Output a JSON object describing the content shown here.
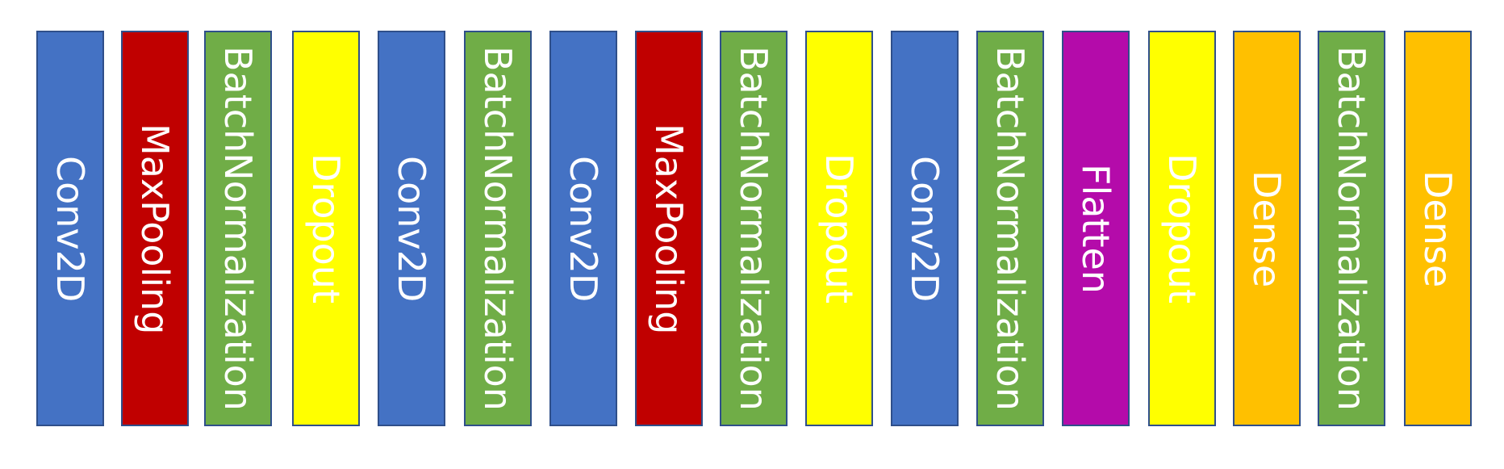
{
  "layers": [
    {
      "label": "Conv2D",
      "color": "#4472C4",
      "text_color": "#ffffff"
    },
    {
      "label": "MaxPooling",
      "color": "#C00000",
      "text_color": "#ffffff"
    },
    {
      "label": "BatchNormalization",
      "color": "#70AD47",
      "text_color": "#ffffff"
    },
    {
      "label": "Dropout",
      "color": "#FFFF00",
      "text_color": "#ffffff"
    },
    {
      "label": "Conv2D",
      "color": "#4472C4",
      "text_color": "#ffffff"
    },
    {
      "label": "BatchNormalization",
      "color": "#70AD47",
      "text_color": "#ffffff"
    },
    {
      "label": "Conv2D",
      "color": "#4472C4",
      "text_color": "#ffffff"
    },
    {
      "label": "MaxPooling",
      "color": "#C00000",
      "text_color": "#ffffff"
    },
    {
      "label": "BatchNormalization",
      "color": "#70AD47",
      "text_color": "#ffffff"
    },
    {
      "label": "Dropout",
      "color": "#FFFF00",
      "text_color": "#ffffff"
    },
    {
      "label": "Conv2D",
      "color": "#4472C4",
      "text_color": "#ffffff"
    },
    {
      "label": "BatchNormalization",
      "color": "#70AD47",
      "text_color": "#ffffff"
    },
    {
      "label": "Flatten",
      "color": "#B40BAA",
      "text_color": "#ffffff"
    },
    {
      "label": "Dropout",
      "color": "#FFFF00",
      "text_color": "#ffffff"
    },
    {
      "label": "Dense",
      "color": "#FFC000",
      "text_color": "#ffffff"
    },
    {
      "label": "BatchNormalization",
      "color": "#70AD47",
      "text_color": "#ffffff"
    },
    {
      "label": "Dense",
      "color": "#FFC000",
      "text_color": "#ffffff"
    }
  ]
}
